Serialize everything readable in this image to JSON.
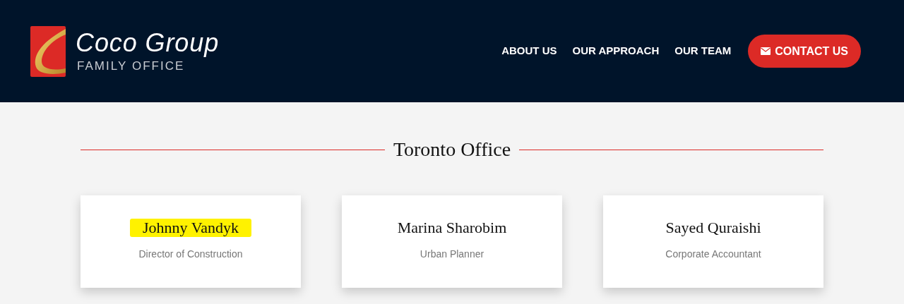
{
  "logo": {
    "name": "Coco Group",
    "tagline": "FAMILY OFFICE"
  },
  "nav": [
    {
      "label": "ABOUT US",
      "kind": "link"
    },
    {
      "label": "OUR APPROACH",
      "kind": "link"
    },
    {
      "label": "OUR TEAM",
      "kind": "link"
    },
    {
      "label": "CONTACT US",
      "kind": "button"
    }
  ],
  "section": {
    "title": "Toronto Office"
  },
  "members": [
    {
      "name": "Johnny Vandyk",
      "role": "Director of Construction",
      "highlighted": true
    },
    {
      "name": "Marina Sharobim",
      "role": "Urban Planner",
      "highlighted": false
    },
    {
      "name": "Sayed Quraishi",
      "role": "Corporate Accountant",
      "highlighted": false
    }
  ]
}
